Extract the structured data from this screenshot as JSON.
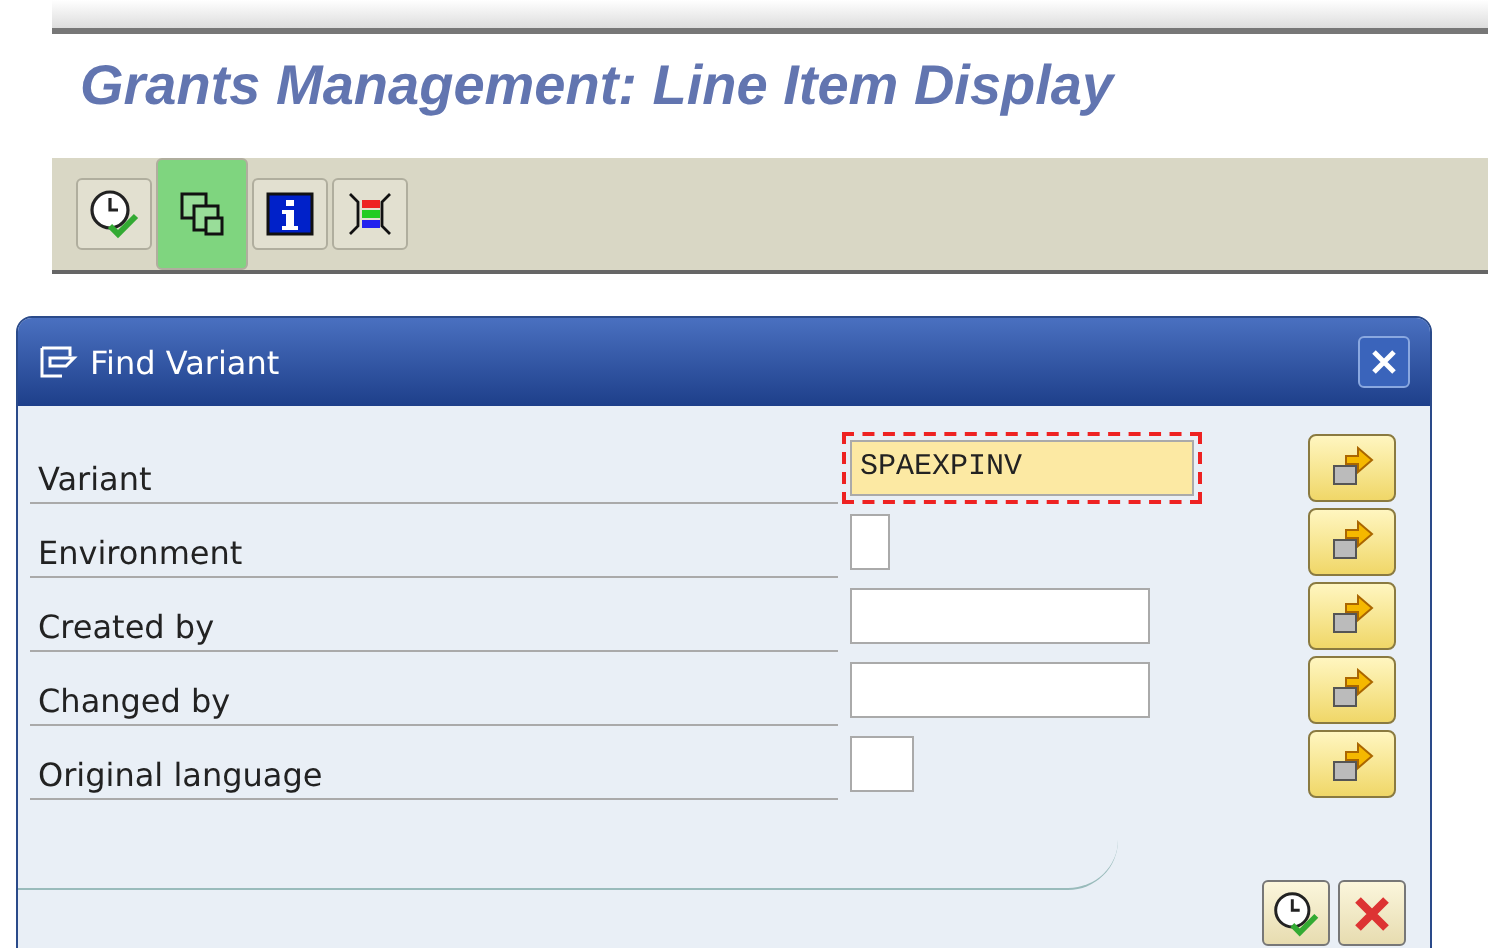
{
  "page_title": "Grants Management: Line Item Display",
  "toolbar": [
    {
      "kind": "execute",
      "selected": false
    },
    {
      "kind": "copy",
      "selected": true
    },
    {
      "kind": "info",
      "selected": false
    },
    {
      "kind": "layout",
      "selected": false
    }
  ],
  "dialog": {
    "title": "Find Variant",
    "fields": [
      {
        "label": "Variant",
        "value": "SPAEXPINV",
        "kind": "wide",
        "focused": true
      },
      {
        "label": "Environment",
        "kind": "tiny",
        "focused": false
      },
      {
        "label": "Created by",
        "kind": "long",
        "focused": false
      },
      {
        "label": "Changed by",
        "kind": "long",
        "focused": false
      },
      {
        "label": "Original language",
        "kind": "short",
        "focused": false
      }
    ]
  }
}
